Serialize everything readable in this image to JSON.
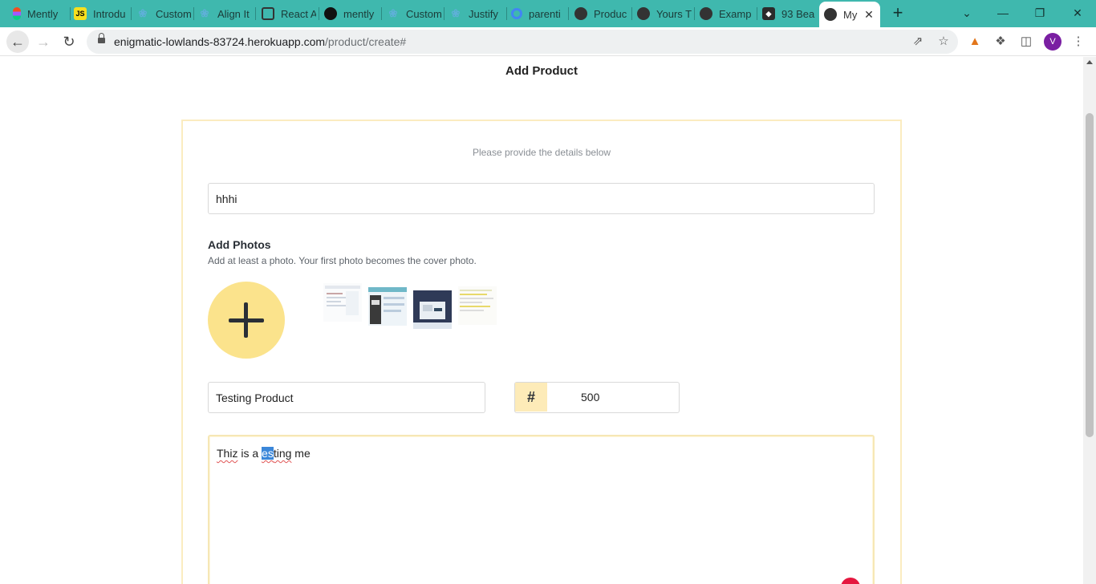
{
  "browser": {
    "tabs": [
      {
        "title": "Mently",
        "icon": "figma-icon",
        "color": "#f24e1e"
      },
      {
        "title": "Introdu",
        "icon": "js-icon",
        "color": "#f7df1e"
      },
      {
        "title": "Custom",
        "icon": "docs-icon",
        "color": "#5fb0d8"
      },
      {
        "title": "Align It",
        "icon": "docs-icon",
        "color": "#5fb0d8"
      },
      {
        "title": "React A",
        "icon": "react-icon",
        "color": "#333333"
      },
      {
        "title": "mently",
        "icon": "github-icon",
        "color": "#111111"
      },
      {
        "title": "Custom",
        "icon": "docs-icon",
        "color": "#5fb0d8"
      },
      {
        "title": "Justify",
        "icon": "docs-icon",
        "color": "#5fb0d8"
      },
      {
        "title": "parenti",
        "icon": "google-icon",
        "color": "#4285f4"
      },
      {
        "title": "Produc",
        "icon": "globe-icon",
        "color": "#333333"
      },
      {
        "title": "Yours T",
        "icon": "globe-icon",
        "color": "#333333"
      },
      {
        "title": "Examp",
        "icon": "globe-icon",
        "color": "#333333"
      },
      {
        "title": "93 Bea",
        "icon": "site-icon",
        "color": "#2b2b2b"
      },
      {
        "title": "My",
        "icon": "globe-icon",
        "color": "#333333",
        "active": true
      }
    ],
    "url_host": "enigmatic-lowlands-83724.herokuapp.com",
    "url_path": "/product/create#",
    "profile_initial": "V"
  },
  "page": {
    "title": "Add Product",
    "subtitle": "Please provide the details below",
    "name_value": "hhhi",
    "photos_heading": "Add Photos",
    "photos_hint": "Add at least a photo. Your first photo becomes the cover photo.",
    "product_name_value": "Testing Product",
    "price_symbol": "#",
    "price_value": "500",
    "description": {
      "part1": "Thiz",
      "part2": " is a ",
      "part3_selected": "es",
      "part4": "ting",
      "part5": " me"
    }
  },
  "colors": {
    "tabstrip": "#3fb8ae",
    "accent_yellow": "#fbe38c",
    "error_red": "#e5173f"
  }
}
